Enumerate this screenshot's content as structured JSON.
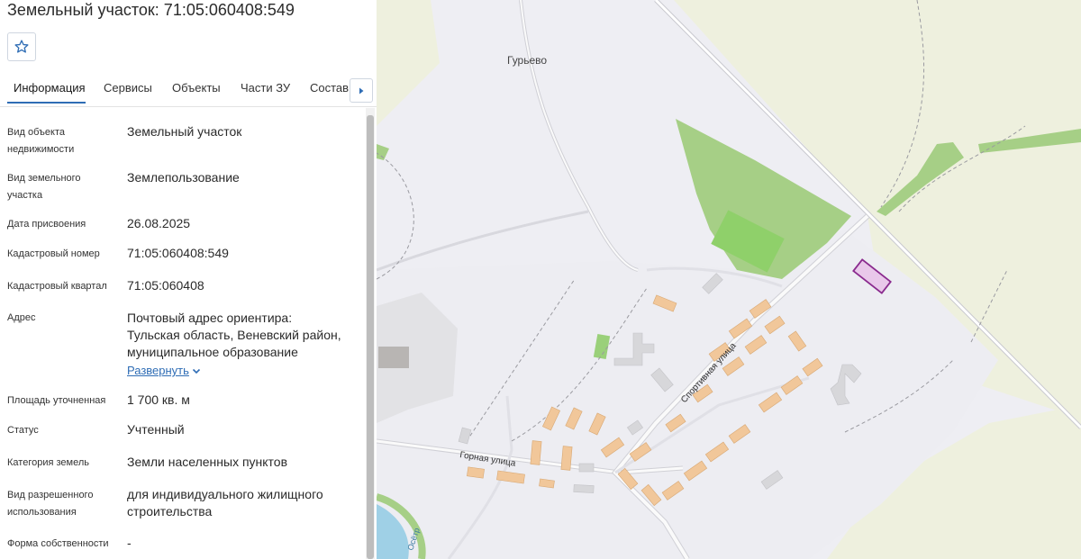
{
  "title": "Земельный участок: 71:05:060408:549",
  "favorite": {
    "icon": "star-outline-icon"
  },
  "tabs": [
    {
      "label": "Информация",
      "active": true
    },
    {
      "label": "Сервисы"
    },
    {
      "label": "Объекты"
    },
    {
      "label": "Части ЗУ"
    },
    {
      "label": "Состав"
    }
  ],
  "tabs_next": {
    "icon": "chevron-right-icon"
  },
  "info": {
    "object_type": {
      "label_1": "Вид объекта",
      "label_2": "недвижимости",
      "value": "Земельный участок"
    },
    "parcel_type": {
      "label_1": "Вид земельного",
      "label_2": "участка",
      "value": "Землепользование"
    },
    "assigned_date": {
      "label": "Дата присвоения",
      "value": "26.08.2025"
    },
    "cadastral_number": {
      "label": "Кадастровый номер",
      "value": "71:05:060408:549"
    },
    "cadastral_quarter": {
      "label": "Кадастровый квартал",
      "value": "71:05:060408"
    },
    "address": {
      "label": "Адрес",
      "line_1": "Почтовый адрес ориентира:",
      "line_2": "Тульская область, Веневский район,",
      "line_3": "муниципальное образование",
      "expand": "Развернуть",
      "expand_icon": "chevron-down-icon"
    },
    "area": {
      "label": "Площадь уточненная",
      "value": "1 700 кв. м"
    },
    "status": {
      "label": "Статус",
      "value": "Учтенный"
    },
    "land_category": {
      "label": "Категория земель",
      "value": "Земли населенных пунктов"
    },
    "permitted_use": {
      "label_1": "Вид разрешенного",
      "label_2": "использования",
      "value_1": "для индивидуального жилищного",
      "value_2": "строительства"
    },
    "ownership": {
      "label": "Форма собственности",
      "value": "-"
    }
  },
  "map": {
    "labels": {
      "village": "Гурьево",
      "street_sport": "Спортивная улица",
      "street_gornaya": "Горная улица",
      "river": "Осётр"
    },
    "colors": {
      "background": "#eeeef3",
      "fields": "#eef0de",
      "greenery": "#a6cf86",
      "buildings": "#f1c79a",
      "parcel_fill": "#e9c8ea",
      "parcel_stroke": "#8a2a8e",
      "water": "#9fd0e6"
    }
  }
}
